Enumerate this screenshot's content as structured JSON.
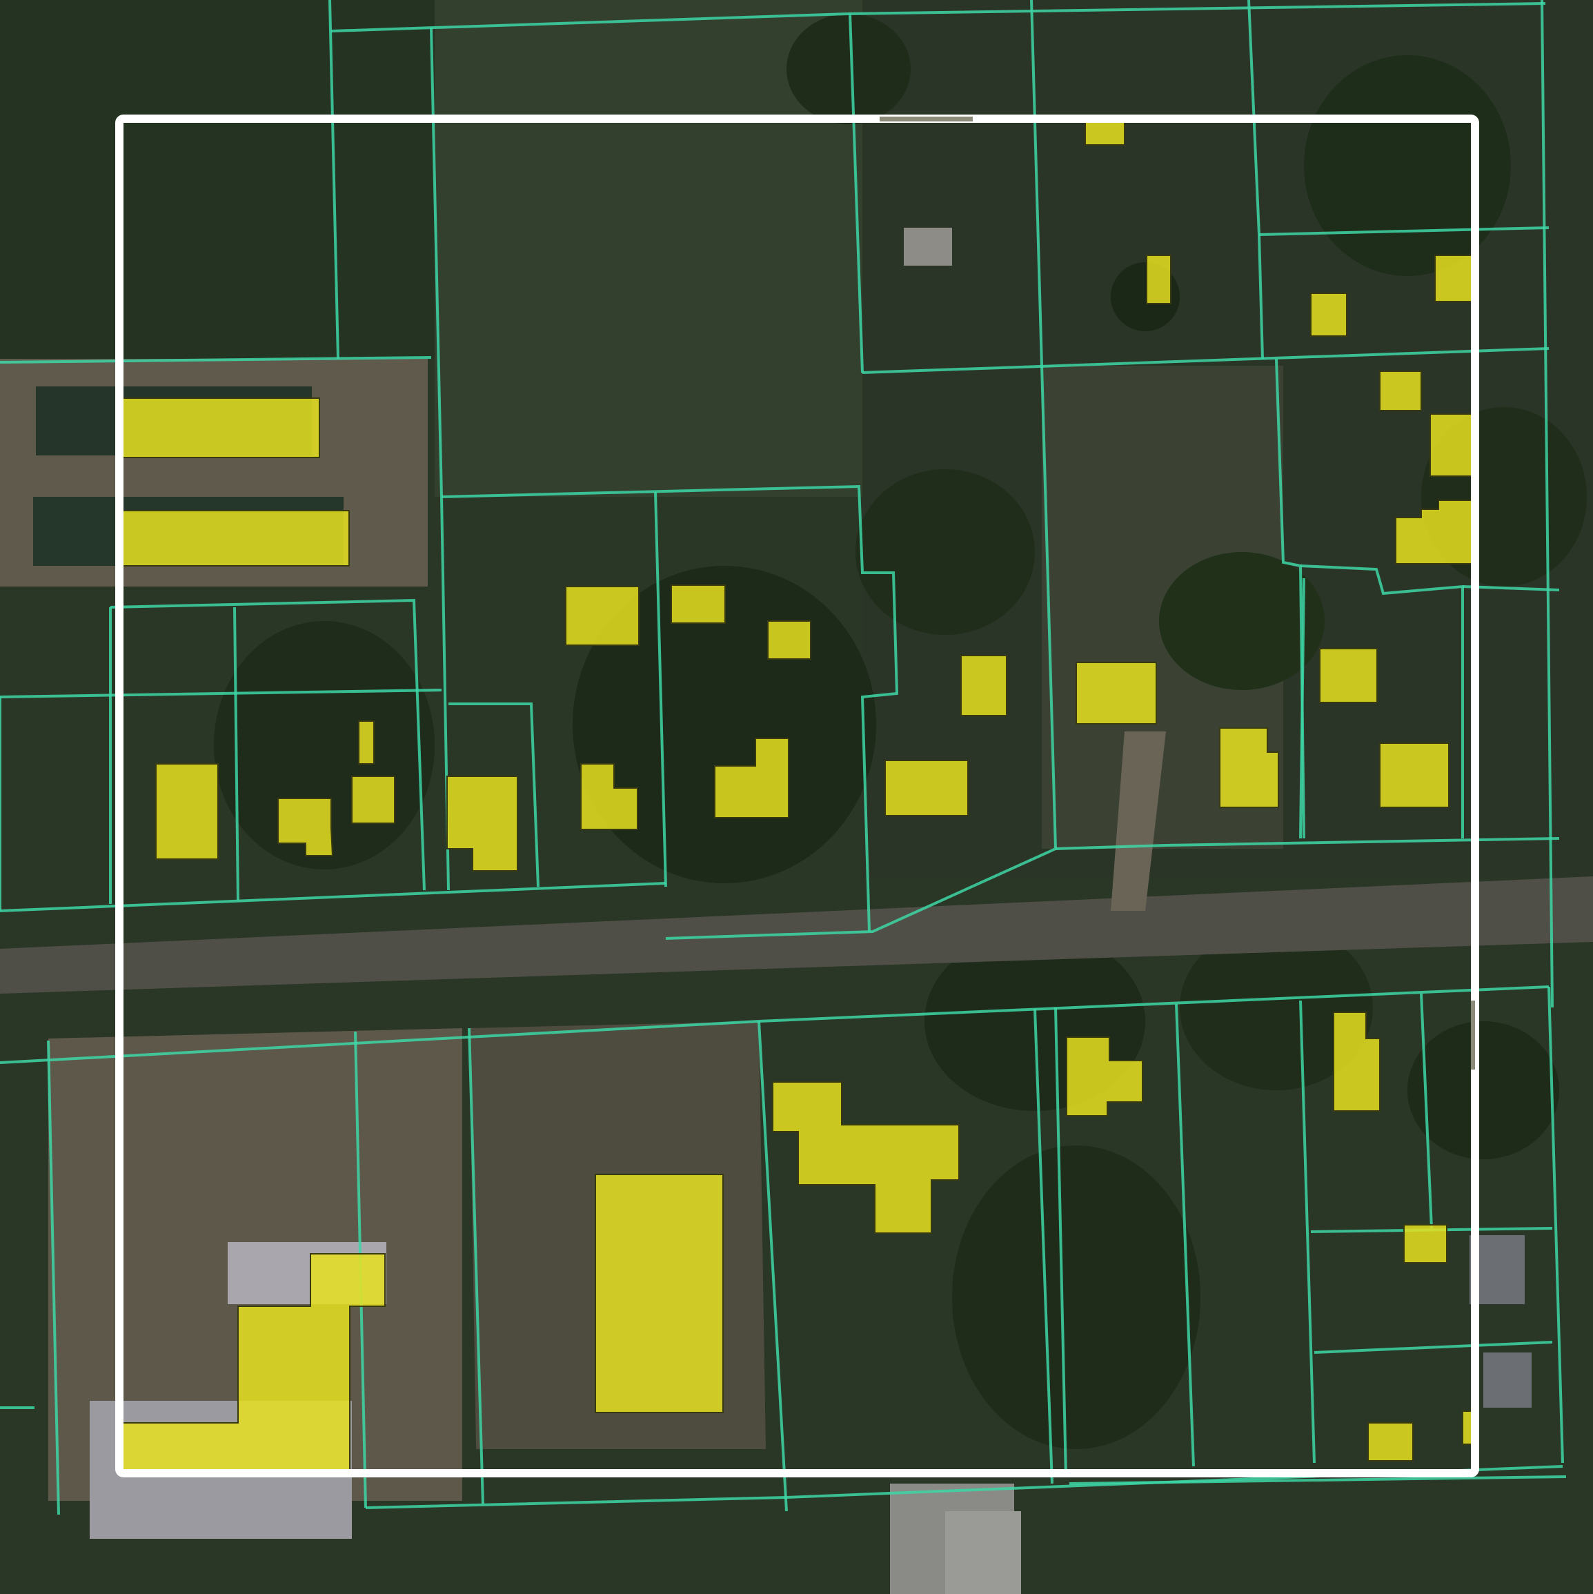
{
  "colors": {
    "parcel_line": "#3dd6a6",
    "footprint_fill": "#e6e021",
    "footprint_stroke": "#3a3a10",
    "selection_box": "#ffffff",
    "vegetation": "#24331f",
    "field": "#2e3a28",
    "road": "#4f4f47",
    "bare_ground": "#6e675a"
  },
  "layers": [
    {
      "name": "imagery",
      "icon": "satellite-imagery"
    },
    {
      "name": "parcels",
      "icon": "parcel-outline"
    },
    {
      "name": "building-footprints",
      "icon": "building-footprint"
    },
    {
      "name": "selection",
      "icon": "selection-box"
    }
  ],
  "building_count": 37
}
